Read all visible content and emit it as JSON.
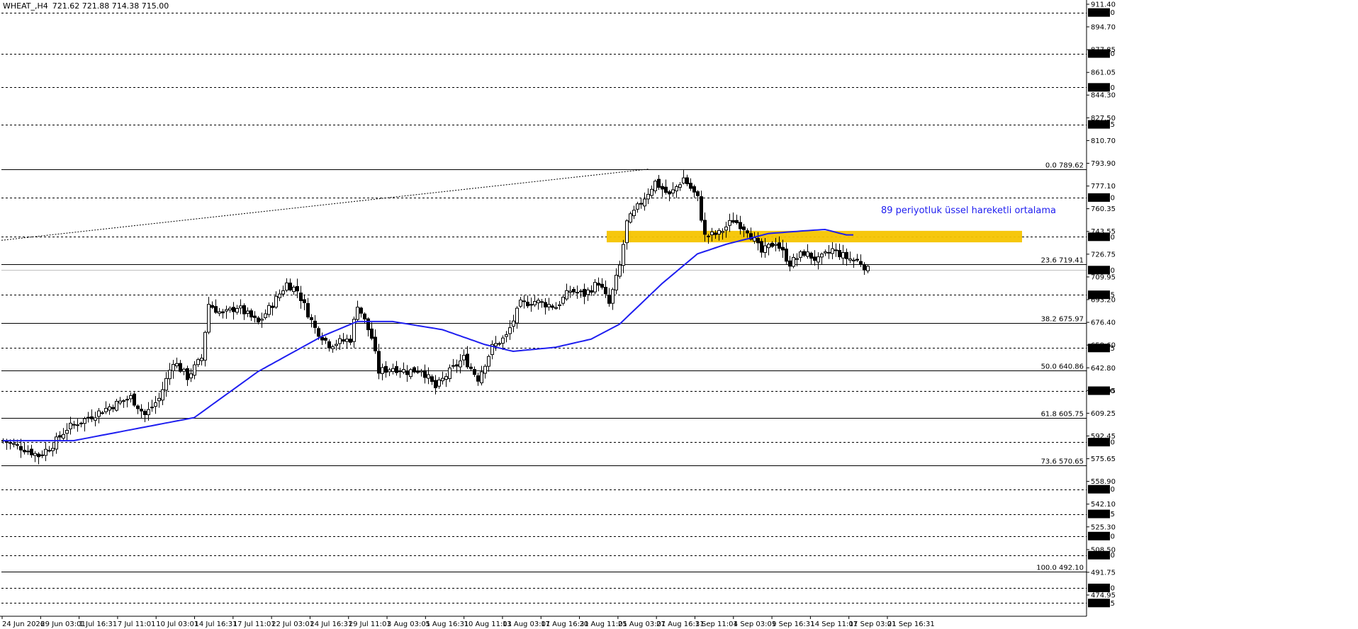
{
  "header": {
    "symbol": "WHEAT_,H4",
    "ohlc": "721.62 721.88 714.38 715.00"
  },
  "annotation": "89 periyotluk üssel hareketli ortalama",
  "colors": {
    "background": "#ffffff",
    "ema": "#1e1ef0",
    "zone": "#f5c400",
    "level_box": "#000000",
    "level_text": "#ffffff"
  },
  "chart_data": {
    "type": "candlestick",
    "symbol": "WHEAT_",
    "timeframe": "H4",
    "x_labels": [
      "24 Jun 2026",
      "29 Jun 03:01",
      "1 Jul 16:31",
      "7 Jul 11:01",
      "10 Jul 03:01",
      "14 Jul 16:31",
      "17 Jul 11:01",
      "22 Jul 03:01",
      "24 Jul 16:31",
      "29 Jul 11:01",
      "3 Aug 03:01",
      "5 Aug 16:31",
      "10 Aug 11:01",
      "13 Aug 03:01",
      "17 Aug 16:31",
      "20 Aug 11:01",
      "25 Aug 03:01",
      "27 Aug 16:31",
      "1 Sep 11:01",
      "4 Sep 03:01",
      "9 Sep 16:31",
      "14 Sep 11:01",
      "17 Sep 03:01",
      "21 Sep 16:31"
    ],
    "ylim": [
      462.4,
      911.4
    ],
    "y_ticks": [
      911.4,
      894.7,
      877.85,
      861.05,
      844.3,
      827.5,
      810.7,
      793.9,
      777.1,
      760.35,
      743.55,
      726.75,
      709.95,
      693.2,
      676.4,
      659.6,
      642.8,
      626.05,
      609.25,
      592.45,
      575.65,
      558.9,
      542.1,
      525.3,
      508.5,
      491.75,
      474.95
    ],
    "level_lines": [
      905.3,
      875.0,
      850.0,
      822.65,
      768.6,
      739.6,
      715.0,
      696.75,
      657.45,
      625.9,
      587.9,
      553.1,
      534.85,
      518.5,
      504.4,
      480.2,
      469.05
    ],
    "current_price": 715.0,
    "fibonacci": [
      {
        "label": "0.0 789.62",
        "value": 789.62
      },
      {
        "label": "23.6 719.41",
        "value": 719.41
      },
      {
        "label": "38.2 675.97",
        "value": 675.97
      },
      {
        "label": "50.0 640.86",
        "value": 640.86
      },
      {
        "label": "61.8 605.75",
        "value": 605.75
      },
      {
        "label": "73.6 570.65",
        "value": 570.65
      },
      {
        "label": "100.0 492.10",
        "value": 492.1
      }
    ],
    "zone": {
      "from": 735.5,
      "to": 744.0,
      "start_label": "25 Aug 03:01"
    },
    "ema_period": 89,
    "close_anchors": [
      {
        "i": 0,
        "v": 589
      },
      {
        "i": 6,
        "v": 583
      },
      {
        "i": 10,
        "v": 578
      },
      {
        "i": 14,
        "v": 586
      },
      {
        "i": 18,
        "v": 598
      },
      {
        "i": 24,
        "v": 606
      },
      {
        "i": 30,
        "v": 614
      },
      {
        "i": 36,
        "v": 621
      },
      {
        "i": 40,
        "v": 608
      },
      {
        "i": 44,
        "v": 620
      },
      {
        "i": 48,
        "v": 648
      },
      {
        "i": 52,
        "v": 636
      },
      {
        "i": 56,
        "v": 650
      },
      {
        "i": 58,
        "v": 690
      },
      {
        "i": 62,
        "v": 682
      },
      {
        "i": 66,
        "v": 688
      },
      {
        "i": 72,
        "v": 676
      },
      {
        "i": 76,
        "v": 690
      },
      {
        "i": 80,
        "v": 705
      },
      {
        "i": 83,
        "v": 700
      },
      {
        "i": 88,
        "v": 672
      },
      {
        "i": 92,
        "v": 660
      },
      {
        "i": 98,
        "v": 664
      },
      {
        "i": 100,
        "v": 690
      },
      {
        "i": 104,
        "v": 665
      },
      {
        "i": 106,
        "v": 640
      },
      {
        "i": 110,
        "v": 643
      },
      {
        "i": 114,
        "v": 640
      },
      {
        "i": 118,
        "v": 642
      },
      {
        "i": 122,
        "v": 628
      },
      {
        "i": 126,
        "v": 640
      },
      {
        "i": 130,
        "v": 650
      },
      {
        "i": 134,
        "v": 635
      },
      {
        "i": 138,
        "v": 658
      },
      {
        "i": 142,
        "v": 666
      },
      {
        "i": 146,
        "v": 690
      },
      {
        "i": 150,
        "v": 692
      },
      {
        "i": 156,
        "v": 688
      },
      {
        "i": 160,
        "v": 700
      },
      {
        "i": 164,
        "v": 697
      },
      {
        "i": 168,
        "v": 706
      },
      {
        "i": 171,
        "v": 690
      },
      {
        "i": 174,
        "v": 718
      },
      {
        "i": 176,
        "v": 750
      },
      {
        "i": 180,
        "v": 765
      },
      {
        "i": 184,
        "v": 780
      },
      {
        "i": 188,
        "v": 770
      },
      {
        "i": 192,
        "v": 783
      },
      {
        "i": 196,
        "v": 768
      },
      {
        "i": 198,
        "v": 740
      },
      {
        "i": 202,
        "v": 742
      },
      {
        "i": 206,
        "v": 752
      },
      {
        "i": 210,
        "v": 745
      },
      {
        "i": 214,
        "v": 728
      },
      {
        "i": 218,
        "v": 736
      },
      {
        "i": 222,
        "v": 720
      },
      {
        "i": 226,
        "v": 728
      },
      {
        "i": 230,
        "v": 722
      },
      {
        "i": 234,
        "v": 730
      },
      {
        "i": 238,
        "v": 724
      },
      {
        "i": 242,
        "v": 721
      },
      {
        "i": 244,
        "v": 715
      }
    ],
    "ema_anchors": [
      {
        "i": 0,
        "v": 589
      },
      {
        "i": 20,
        "v": 589
      },
      {
        "i": 36,
        "v": 597
      },
      {
        "i": 54,
        "v": 606
      },
      {
        "i": 72,
        "v": 640
      },
      {
        "i": 90,
        "v": 666
      },
      {
        "i": 100,
        "v": 677
      },
      {
        "i": 110,
        "v": 677
      },
      {
        "i": 124,
        "v": 671
      },
      {
        "i": 136,
        "v": 660
      },
      {
        "i": 144,
        "v": 655
      },
      {
        "i": 156,
        "v": 658
      },
      {
        "i": 166,
        "v": 664
      },
      {
        "i": 174,
        "v": 675
      },
      {
        "i": 186,
        "v": 705
      },
      {
        "i": 196,
        "v": 727
      },
      {
        "i": 204,
        "v": 734
      },
      {
        "i": 216,
        "v": 742
      },
      {
        "i": 226,
        "v": 744
      },
      {
        "i": 232,
        "v": 745
      },
      {
        "i": 238,
        "v": 741
      }
    ]
  }
}
